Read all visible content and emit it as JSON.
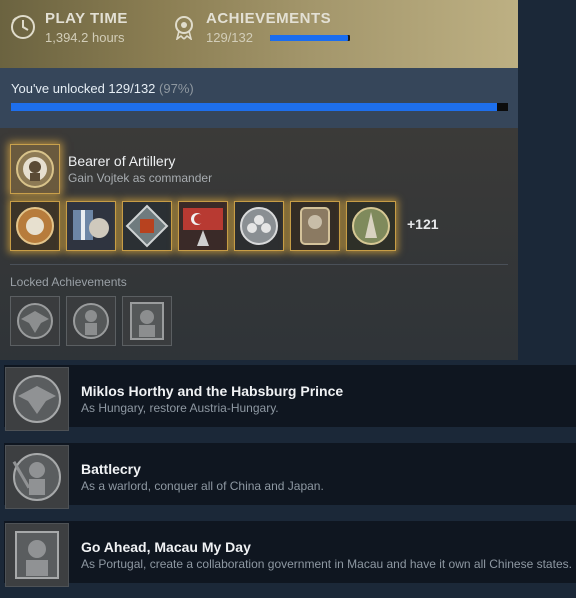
{
  "header": {
    "playtime": {
      "label": "PLAY TIME",
      "value": "1,394.2 hours",
      "icon": "clock-icon"
    },
    "achievements": {
      "label": "ACHIEVEMENTS",
      "value": "129/132",
      "icon": "badge-icon",
      "progress": 0.97
    }
  },
  "progress": {
    "text": "You've unlocked 129/132",
    "percent": "(97%)",
    "fraction": 0.977
  },
  "recent": {
    "title": "Bearer of Artillery",
    "description": "Gain Vojtek as commander",
    "icon": "bear-artillery-icon"
  },
  "unlocked_icons": [
    {
      "name": "achievement-icon-1",
      "color": "#b77c3c"
    },
    {
      "name": "achievement-icon-2",
      "color": "#6d86a6"
    },
    {
      "name": "achievement-icon-3",
      "color": "#6f7b7e"
    },
    {
      "name": "achievement-icon-4",
      "color": "#b83a32"
    },
    {
      "name": "achievement-icon-5",
      "color": "#8a8f93"
    },
    {
      "name": "achievement-icon-6",
      "color": "#8b7a62"
    },
    {
      "name": "achievement-icon-7",
      "color": "#7f8a5c"
    }
  ],
  "more_count": "+121",
  "locked": {
    "label": "Locked Achievements"
  },
  "list": [
    {
      "title": "Miklos Horthy and the Habsburg Prince",
      "desc": "As Hungary, restore Austria-Hungary.",
      "icon": "eagle-icon"
    },
    {
      "title": "Battlecry",
      "desc": "As a warlord, conquer all of China and Japan.",
      "icon": "soldier-icon"
    },
    {
      "title": "Go Ahead, Macau My Day",
      "desc": "As Portugal, create a collaboration government in Macau and have it own all Chinese states.",
      "icon": "portrait-icon"
    }
  ],
  "colors": {
    "accent": "#1e6fec",
    "gold_glow": "#d7a53c",
    "bg": "#1b2838"
  }
}
